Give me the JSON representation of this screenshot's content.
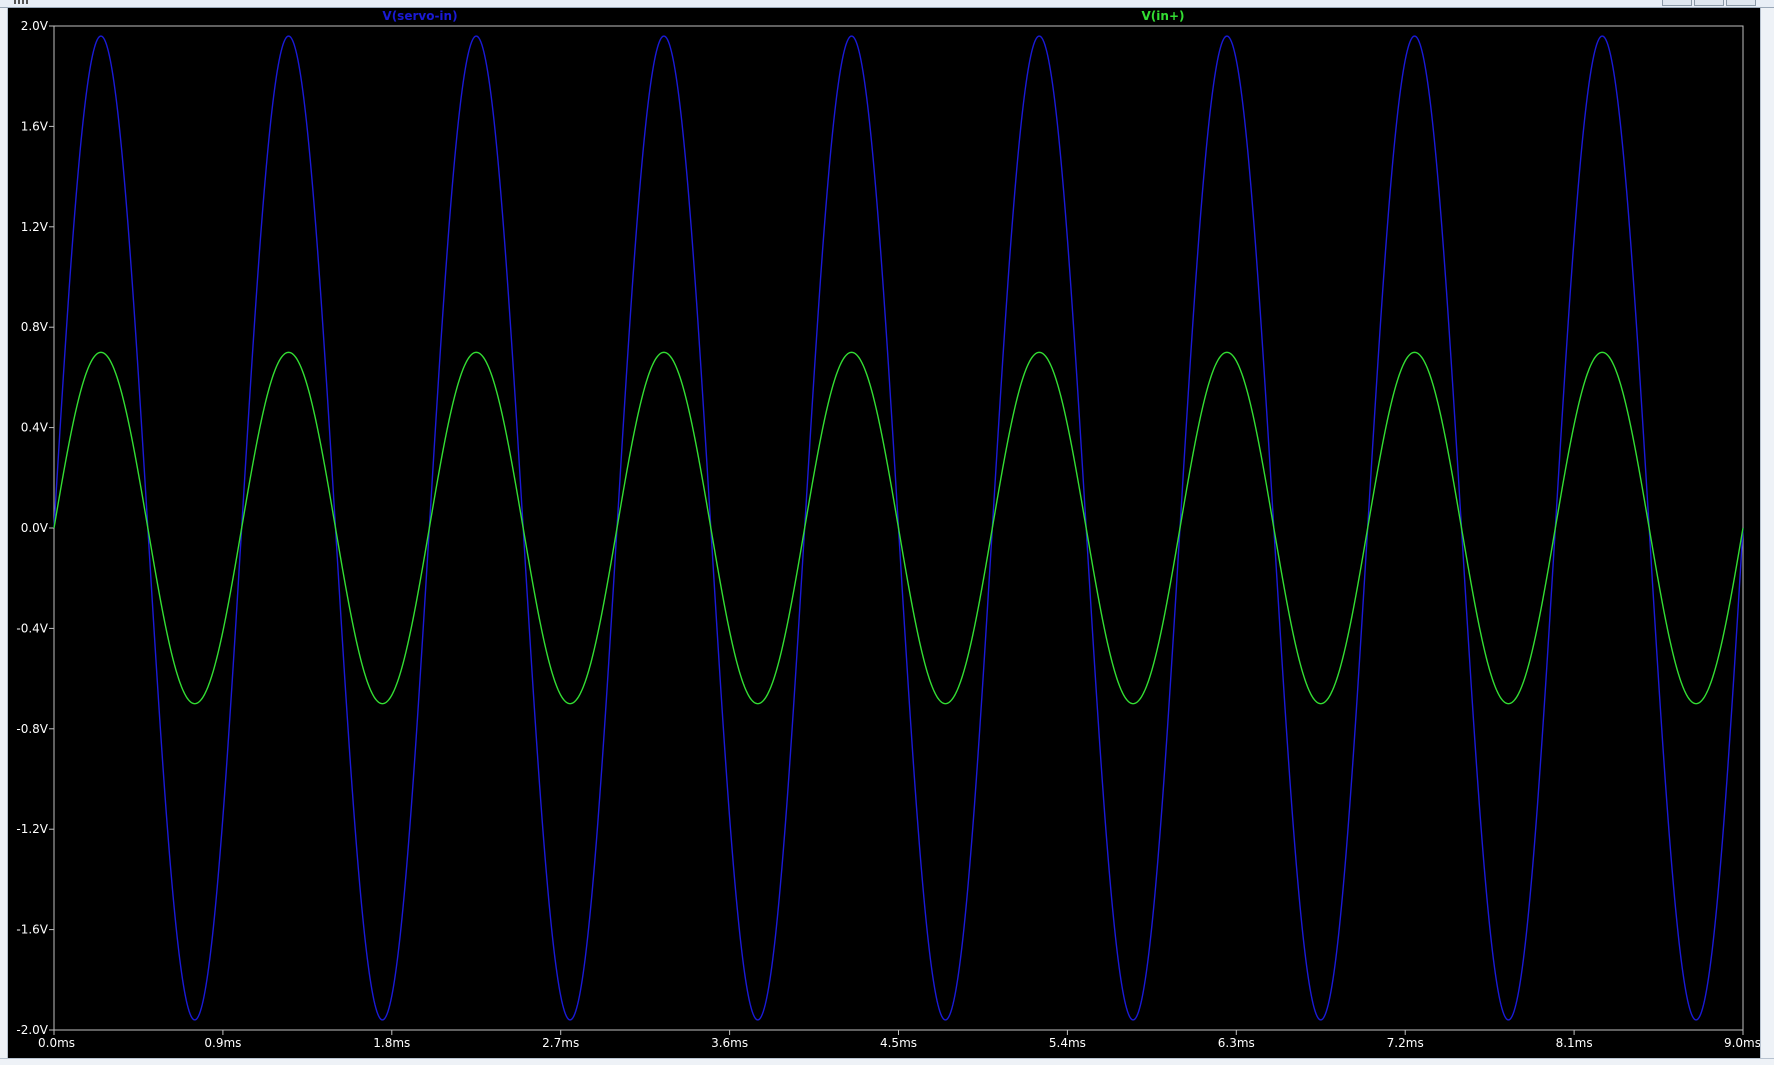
{
  "window": {
    "background_color": "#000000",
    "frame_color": "#eef2f7"
  },
  "chart_data": {
    "type": "line",
    "title": "",
    "xlabel": "",
    "ylabel": "",
    "x_unit": "ms",
    "y_unit": "V",
    "xlim": [
      0.0,
      9.0
    ],
    "ylim": [
      -2.0,
      2.0
    ],
    "grid": false,
    "legend_position": "top",
    "x_ticks": [
      0.0,
      0.9,
      1.8,
      2.7,
      3.6,
      4.5,
      5.4,
      6.3,
      7.2,
      8.1,
      9.0
    ],
    "x_tick_labels": [
      "0.0ms",
      "0.9ms",
      "1.8ms",
      "2.7ms",
      "3.6ms",
      "4.5ms",
      "5.4ms",
      "6.3ms",
      "7.2ms",
      "8.1ms",
      "9.0ms"
    ],
    "y_ticks": [
      2.0,
      1.6,
      1.2,
      0.8,
      0.4,
      0.0,
      -0.4,
      -0.8,
      -1.2,
      -1.6,
      -2.0
    ],
    "y_tick_labels": [
      "2.0V",
      "1.6V",
      "1.2V",
      "0.8V",
      "0.4V",
      "0.0V",
      "-0.4V",
      "-0.8V",
      "-1.2V",
      "-1.6V",
      "-2.0V"
    ],
    "series": [
      {
        "name": "V(servo-in)",
        "color": "#1a1ad6",
        "waveform": "sine",
        "amplitude": 1.96,
        "frequency_khz": 1.0,
        "phase_deg": 0,
        "offset": 0.0,
        "x": [
          0.0,
          0.25,
          0.5,
          0.75,
          1.0,
          1.25,
          1.5,
          1.75,
          2.0,
          2.25,
          2.5,
          2.75,
          3.0,
          3.25,
          3.5,
          3.75,
          4.0,
          4.25,
          4.5,
          4.75,
          5.0,
          5.25,
          5.5,
          5.75,
          6.0,
          6.25,
          6.5,
          6.75,
          7.0,
          7.25,
          7.5,
          7.75,
          8.0,
          8.25,
          8.5,
          8.75,
          9.0
        ],
        "values": [
          0.0,
          1.96,
          0.0,
          -1.96,
          0.0,
          1.96,
          0.0,
          -1.96,
          0.0,
          1.96,
          0.0,
          -1.96,
          0.0,
          1.96,
          0.0,
          -1.96,
          0.0,
          1.96,
          0.0,
          -1.96,
          0.0,
          1.96,
          0.0,
          -1.96,
          0.0,
          1.96,
          0.0,
          -1.96,
          0.0,
          1.96,
          0.0,
          -1.96,
          0.0,
          1.96,
          0.0,
          -1.96,
          0.0
        ]
      },
      {
        "name": "V(in+)",
        "color": "#33dd33",
        "waveform": "sine",
        "amplitude": 0.7,
        "frequency_khz": 1.0,
        "phase_deg": 0,
        "offset": 0.0,
        "x": [
          0.0,
          0.25,
          0.5,
          0.75,
          1.0,
          1.25,
          1.5,
          1.75,
          2.0,
          2.25,
          2.5,
          2.75,
          3.0,
          3.25,
          3.5,
          3.75,
          4.0,
          4.25,
          4.5,
          4.75,
          5.0,
          5.25,
          5.5,
          5.75,
          6.0,
          6.25,
          6.5,
          6.75,
          7.0,
          7.25,
          7.5,
          7.75,
          8.0,
          8.25,
          8.5,
          8.75,
          9.0
        ],
        "values": [
          0.0,
          0.7,
          0.0,
          -0.7,
          0.0,
          0.7,
          0.0,
          -0.7,
          0.0,
          0.7,
          0.0,
          -0.7,
          0.0,
          0.7,
          0.0,
          -0.7,
          0.0,
          0.7,
          0.0,
          -0.7,
          0.0,
          0.7,
          0.0,
          -0.7,
          0.0,
          0.7,
          0.0,
          -0.7,
          0.0,
          0.7,
          0.0,
          -0.7,
          0.0,
          0.7,
          0.0,
          -0.7,
          0.0
        ]
      }
    ]
  }
}
